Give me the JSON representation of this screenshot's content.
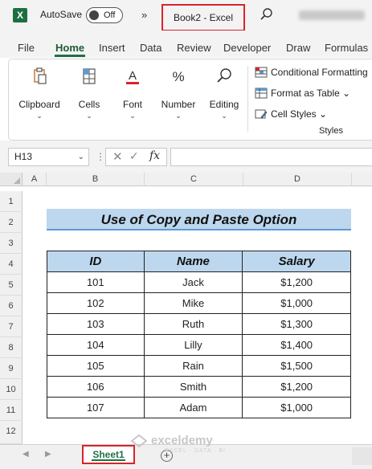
{
  "titlebar": {
    "autosave_label": "AutoSave",
    "autosave_state": "Off",
    "more": "»",
    "doc_title": "Book2  -  Excel"
  },
  "tabs": [
    "File",
    "Home",
    "Insert",
    "Data",
    "Review",
    "Developer",
    "Draw",
    "Formulas"
  ],
  "active_tab": "Home",
  "ribbon": {
    "groups": [
      {
        "label": "Clipboard",
        "icon": "clipboard-icon"
      },
      {
        "label": "Cells",
        "icon": "cells-icon"
      },
      {
        "label": "Font",
        "icon": "font-icon"
      },
      {
        "label": "Number",
        "icon": "percent-icon"
      },
      {
        "label": "Editing",
        "icon": "search-icon"
      }
    ],
    "styles": {
      "conditional_formatting": "Conditional Formatting",
      "format_as_table": "Format as Table",
      "cell_styles": "Cell Styles",
      "group_label": "Styles"
    }
  },
  "formula_bar": {
    "name_box": "H13",
    "fx": "fx",
    "formula": ""
  },
  "columns": [
    "A",
    "B",
    "C",
    "D"
  ],
  "rows": [
    "1",
    "2",
    "3",
    "4",
    "5",
    "6",
    "7",
    "8",
    "9",
    "10",
    "11",
    "12"
  ],
  "sheet": {
    "title": "Use of Copy and Paste Option",
    "headers": [
      "ID",
      "Name",
      "Salary"
    ],
    "records": [
      [
        "101",
        "Jack",
        "$1,200"
      ],
      [
        "102",
        "Mike",
        "$1,000"
      ],
      [
        "103",
        "Ruth",
        "$1,300"
      ],
      [
        "104",
        "Lilly",
        "$1,400"
      ],
      [
        "105",
        "Rain",
        "$1,500"
      ],
      [
        "106",
        "Smith",
        "$1,200"
      ],
      [
        "107",
        "Adam",
        "$1,000"
      ]
    ]
  },
  "sheet_tabs": {
    "active": "Sheet1",
    "add": "+"
  },
  "watermark": {
    "brand": "exceldemy",
    "tagline": "EXCEL · DATA · BI"
  },
  "colors": {
    "excel_green": "#1e7145",
    "highlight_red": "#d9242b",
    "header_fill": "#bdd7ee"
  }
}
